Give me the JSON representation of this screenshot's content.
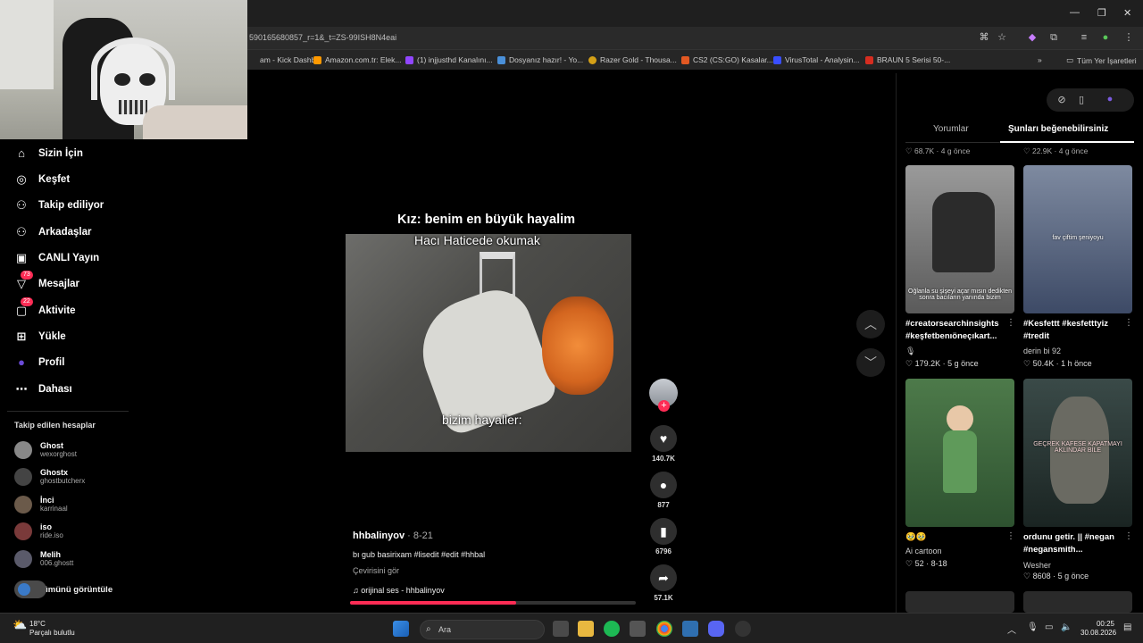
{
  "browser": {
    "url": "590165680857_r=1&_t=ZS-99ISH8N4eai",
    "bookmarks": [
      {
        "label": "am - Kick Dashb...",
        "color": "#53fc18"
      },
      {
        "label": "Amazon.com.tr: Elek...",
        "color": "#ff9900"
      },
      {
        "label": "(1) injjusthd Kanalını...",
        "color": "#9146ff"
      },
      {
        "label": "Dosyanız hazır! - Yo...",
        "color": "#4a90d9"
      },
      {
        "label": "Razer Gold - Thousa...",
        "color": "#d4a017"
      },
      {
        "label": "CS2 (CS:GO) Kasalar...",
        "color": "#e25822"
      },
      {
        "label": "VirusTotal - Analysin...",
        "color": "#394eff"
      },
      {
        "label": "BRAUN 5 Serisi 50-...",
        "color": "#d62d20"
      }
    ],
    "all_bookmarks": "Tüm Yer İşaretleri"
  },
  "sidebar": {
    "items": [
      {
        "label": "Sizin İçin",
        "icon": "home-icon",
        "glyph": "⌂"
      },
      {
        "label": "Keşfet",
        "icon": "compass-icon",
        "glyph": "◎"
      },
      {
        "label": "Takip ediliyor",
        "icon": "following-icon",
        "glyph": "⚇"
      },
      {
        "label": "Arkadaşlar",
        "icon": "friends-icon",
        "glyph": "⚇"
      },
      {
        "label": "CANLI Yayın",
        "icon": "live-icon",
        "glyph": "▣"
      },
      {
        "label": "Mesajlar",
        "icon": "messages-icon",
        "glyph": "▽",
        "badge": "73"
      },
      {
        "label": "Aktivite",
        "icon": "activity-icon",
        "glyph": "▢",
        "badge": "22"
      },
      {
        "label": "Yükle",
        "icon": "upload-icon",
        "glyph": "⊞"
      },
      {
        "label": "Profil",
        "icon": "profile-icon",
        "glyph": "●"
      },
      {
        "label": "Dahası",
        "icon": "more-icon",
        "glyph": "⋯"
      }
    ],
    "following_title": "Takip edilen hesaplar",
    "accounts": [
      {
        "name": "Ghost",
        "handle": "wexorghost"
      },
      {
        "name": "Ghostx",
        "handle": "ghostbutcherx"
      },
      {
        "name": "İnci",
        "handle": "karrinaal"
      },
      {
        "name": "iso",
        "handle": "ride.iso"
      },
      {
        "name": "Melih",
        "handle": "006.ghostt"
      }
    ],
    "see_all": "ümünü görüntüle"
  },
  "video": {
    "caption_top": "Kız: benim en büyük hayalim",
    "caption_line2": "Hacı Haticede okumak",
    "caption_bottom": "bizim hayaller:",
    "author": "hhbalinyov",
    "date": "· 8-21",
    "description": "bı gub basirixam #lisedit #edit #hhbal",
    "translate": "Çevirisini gör",
    "music": "♫  orijinal ses - hhbalinyov",
    "progress": 0.58
  },
  "actions": {
    "likes": "140.7K",
    "comments": "877",
    "saves": "6796",
    "shares": "57.1K"
  },
  "right_panel": {
    "tabs": [
      "Yorumlar",
      "Şunları beğenebilirsiniz"
    ],
    "cut_stats": [
      "♡ 68.7K · 4 g önce",
      "♡ 22.9K · 4 g önce"
    ],
    "cards": [
      {
        "title": "#creatorsearchinsights #keşfetbenıöneçıkart...",
        "sub": "🎙",
        "stat": "♡ 179.2K · 5 g önce",
        "overlay": "Oğlanla su şişeyi açar mısın dedikten sonra bacıların yanında bizim"
      },
      {
        "title": "#Kesfettt #kesfetttyiz #tredit",
        "sub": "derin bi 92",
        "stat": "♡ 50.4K · 1 h önce",
        "overlay": "fav çiftim şeniyoyu"
      },
      {
        "title": "🥹🥹",
        "sub": "Ai cartoon",
        "stat": "♡ 52 · 8-18",
        "overlay": ""
      },
      {
        "title": "ordunu getir. || #negan #negansmith...",
        "sub": "Wesher",
        "stat": "♡ 8608 · 5 g önce",
        "overlay": "GEÇREK KAFESE KAPATMAYI AKLINDAR BİLE"
      }
    ]
  },
  "taskbar": {
    "temp": "18°C",
    "weather": "Parçalı bulutlu",
    "search": "Ara",
    "time": "00:25",
    "date": "30.08.2026"
  }
}
